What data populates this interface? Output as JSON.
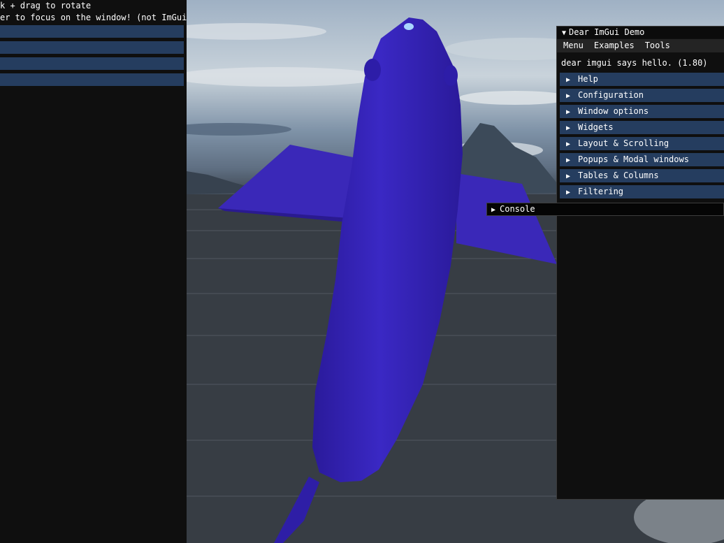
{
  "left_panel": {
    "lines": [
      "k + drag to rotate",
      "er to focus on the window! (not ImGui)"
    ]
  },
  "demo_window": {
    "title": "Dear ImGui Demo",
    "title_arrow": "▼",
    "menus": [
      "Menu",
      "Examples",
      "Tools"
    ],
    "hello_text": "dear imgui says hello. (1.80)",
    "sections": [
      "Help",
      "Configuration",
      "Window options",
      "Widgets",
      "Layout & Scrolling",
      "Popups & Modal windows",
      "Tables & Columns",
      "Filtering"
    ],
    "collapsed_arrow": "▶"
  },
  "console_window": {
    "title": "Console",
    "arrow": "▶"
  },
  "scene": {
    "model_color": "#3623b4",
    "fish_highlight": "#a9d6ff",
    "water_color": "#33393f",
    "sky_color": "#9fb1c4"
  }
}
